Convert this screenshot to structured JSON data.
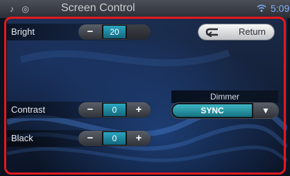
{
  "status_bar": {
    "left_icons": "♪ ◎",
    "title": "Screen Control",
    "right_icon": "wifi-icon",
    "time": "5:09"
  },
  "bright": {
    "label": "Bright",
    "value": "20",
    "minus": "−",
    "plus": "+"
  },
  "contrast": {
    "label": "Contrast",
    "value": "0",
    "minus": "−",
    "plus": "+"
  },
  "black": {
    "label": "Black",
    "value": "0",
    "minus": "−",
    "plus": "+"
  },
  "return_button": {
    "label": "Return",
    "icon": "return-arrow-icon"
  },
  "dimmer": {
    "title": "Dimmer",
    "value": "SYNC",
    "arrow": "▼"
  },
  "colors": {
    "frame": "#e5191f",
    "value_cell": "#2aa7c2",
    "background": "#0b1220"
  }
}
